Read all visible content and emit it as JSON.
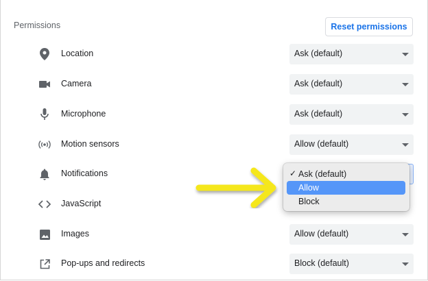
{
  "section_title": "Permissions",
  "reset_button": "Reset permissions",
  "permissions": [
    {
      "label": "Location",
      "value": "Ask (default)",
      "icon": "location-pin-icon"
    },
    {
      "label": "Camera",
      "value": "Ask (default)",
      "icon": "camera-icon"
    },
    {
      "label": "Microphone",
      "value": "Ask (default)",
      "icon": "microphone-icon"
    },
    {
      "label": "Motion sensors",
      "value": "Allow (default)",
      "icon": "motion-sensors-icon"
    },
    {
      "label": "Notifications",
      "value": "",
      "icon": "bell-icon"
    },
    {
      "label": "JavaScript",
      "value": "",
      "icon": "code-brackets-icon"
    },
    {
      "label": "Images",
      "value": "Allow (default)",
      "icon": "image-icon"
    },
    {
      "label": "Pop-ups and redirects",
      "value": "Block (default)",
      "icon": "popup-icon"
    }
  ],
  "dropdown": {
    "options": [
      "Ask (default)",
      "Allow",
      "Block"
    ],
    "checked": "Ask (default)",
    "highlighted": "Allow"
  },
  "colors": {
    "accent": "#1a73e8",
    "highlight": "#5596f8",
    "arrow": "#f5e71a"
  }
}
